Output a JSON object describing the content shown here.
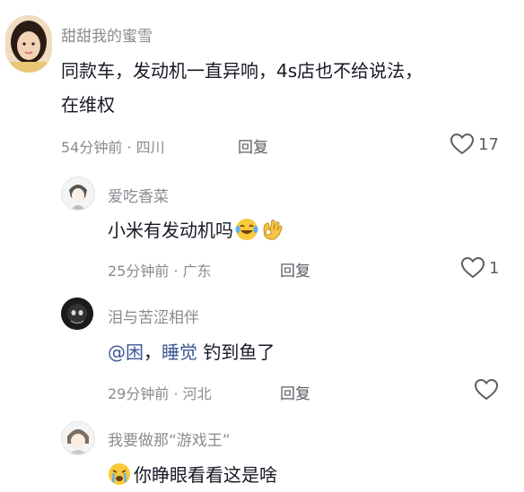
{
  "comments": [
    {
      "username": "甜甜我的蜜雪",
      "content_line1": "同款车，发动机一直异响，4s店也不给说法，",
      "content_line2": "在维权",
      "time": "54分钟前",
      "location": "四川",
      "reply_label": "回复",
      "likes": "17"
    },
    {
      "username": "爱吃香菜",
      "content": "小米有发动机吗",
      "emoji1": "laughing-crying-emoji",
      "emoji2": "ok-hand-emoji",
      "time": "25分钟前",
      "location": "广东",
      "reply_label": "回复",
      "likes": "1"
    },
    {
      "username": "泪与苦涩相伴",
      "mention": "@困",
      "content_mid": "，",
      "mention2": "睡觉",
      "content_end": " 钓到鱼了",
      "time": "29分钟前",
      "location": "河北",
      "reply_label": "回复",
      "likes": ""
    },
    {
      "username": "我要做那“游戏王”",
      "emoji": "crying-emoji",
      "content": "你睁眼看看这是啥"
    }
  ],
  "meta_separator": " · ",
  "colors": {
    "secondary": "#8a8b91",
    "mention": "#3b5795",
    "text": "#161823"
  }
}
